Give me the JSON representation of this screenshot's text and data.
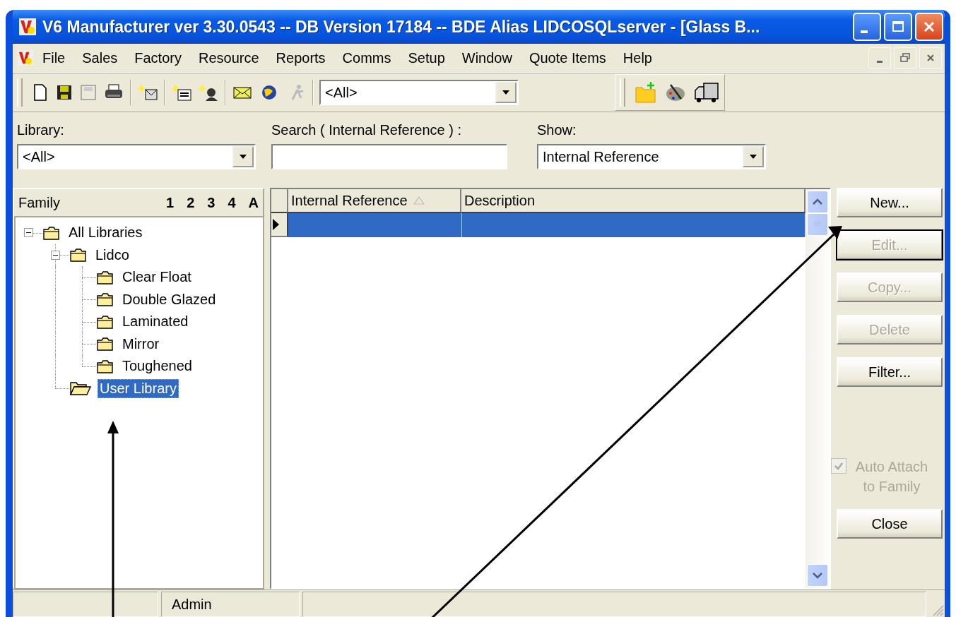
{
  "window": {
    "title": "V6 Manufacturer ver 3.30.0543 -- DB Version 17184 -- BDE Alias LIDCOSQLserver - [Glass B..."
  },
  "menu": [
    "File",
    "Sales",
    "Factory",
    "Resource",
    "Reports",
    "Comms",
    "Setup",
    "Window",
    "Quote Items",
    "Help"
  ],
  "toolbar": {
    "combo_value": "<All>"
  },
  "filters": {
    "library_label": "Library:",
    "library_value": "<All>",
    "search_label": "Search ( Internal Reference ) :",
    "show_label": "Show:",
    "show_value": "Internal Reference"
  },
  "family": {
    "title": "Family",
    "levels": [
      "1",
      "2",
      "3",
      "4",
      "A"
    ],
    "tree": [
      {
        "label": "All Libraries",
        "expanded": true,
        "selected": false,
        "children": [
          {
            "label": "Lidco",
            "expanded": true,
            "selected": false,
            "children": [
              {
                "label": "Clear Float",
                "selected": false
              },
              {
                "label": "Double Glazed",
                "selected": false
              },
              {
                "label": "Laminated",
                "selected": false
              },
              {
                "label": "Mirror",
                "selected": false
              },
              {
                "label": "Toughened",
                "selected": false
              }
            ]
          },
          {
            "label": "User Library",
            "selected": true
          }
        ]
      }
    ]
  },
  "grid": {
    "columns": [
      {
        "label": "Internal Reference",
        "sorted": true
      },
      {
        "label": "Description",
        "sorted": false
      }
    ],
    "rows": [
      {
        "selected": true,
        "current": true
      }
    ]
  },
  "buttons": [
    {
      "label": "New...",
      "disabled": false,
      "default": false
    },
    {
      "label": "Edit...",
      "disabled": true,
      "default": true
    },
    {
      "label": "Copy...",
      "disabled": true,
      "default": false
    },
    {
      "label": "Delete",
      "disabled": true,
      "default": false
    },
    {
      "label": "Filter...",
      "disabled": false,
      "default": false
    }
  ],
  "auto_attach": {
    "label": "Auto Attach to Family",
    "checked": true,
    "disabled": true
  },
  "close_button": {
    "label": "Close",
    "disabled": false
  },
  "status_bar": {
    "user": "Admin"
  }
}
